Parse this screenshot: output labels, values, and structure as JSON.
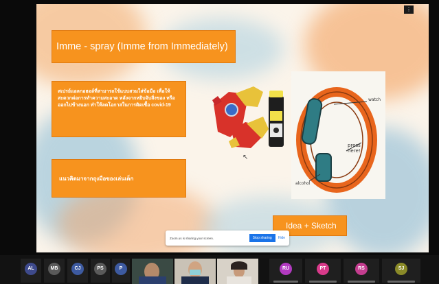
{
  "slide": {
    "title": "Imme - spray (Imme from Immediately)",
    "description": "สเปรย์แอลกอฮอล์ที่สามารถใช้แบบสวมใส่ข้อมือ เพื่อให้สะดวกต่อการทำความสะอาด หลังจากหยิบจับสิ่งของ หรือออกไปข้างนอก ทำให้ลดโอกาสในการติดเชื้อ covid-19",
    "inspiration": "แนวคิดมาจากถุงมือของเล่นเด็ก",
    "idea_label": "Idea + Sketch",
    "sketch_labels": {
      "top": "watch",
      "middle": "press here!",
      "bottom": "alcohol"
    }
  },
  "notification": {
    "message": "Zoom.us is sharing your screen.",
    "share_button": "Stop sharing",
    "hide_button": "Hide"
  },
  "participants": [
    {
      "initials": "AL",
      "color": "#3e4a8c"
    },
    {
      "initials": "MB",
      "color": "#5a5a5a"
    },
    {
      "initials": "CJ",
      "color": "#3d5aa0"
    },
    {
      "initials": "PS",
      "color": "#5a5a5a"
    },
    {
      "initials": "P",
      "color": "#3d5aa0"
    },
    {
      "initials": "RU",
      "color": "#b23ac0"
    },
    {
      "initials": "PT",
      "color": "#d83a8a"
    },
    {
      "initials": "RS",
      "color": "#c43d8f"
    },
    {
      "initials": "SJ",
      "color": "#8a8a28"
    }
  ]
}
